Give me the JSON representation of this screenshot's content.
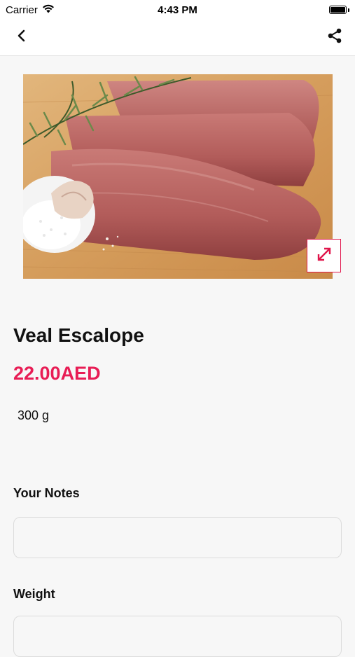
{
  "status_bar": {
    "carrier": "Carrier",
    "time": "4:43 PM"
  },
  "nav": {
    "back_icon": "chevron-left-icon",
    "share_icon": "share-icon"
  },
  "product": {
    "name": "Veal Escalope",
    "price": "22.00AED",
    "quantity": "300 g",
    "image_subject": "raw veal with rosemary, garlic and salt on wooden board",
    "expand_icon": "expand-arrows-icon"
  },
  "notes": {
    "label": "Your Notes",
    "value": ""
  },
  "weight": {
    "label": "Weight",
    "value": ""
  },
  "colors": {
    "accent": "#e81d55",
    "background": "#f7f7f7",
    "nav_background": "#ffffff"
  }
}
